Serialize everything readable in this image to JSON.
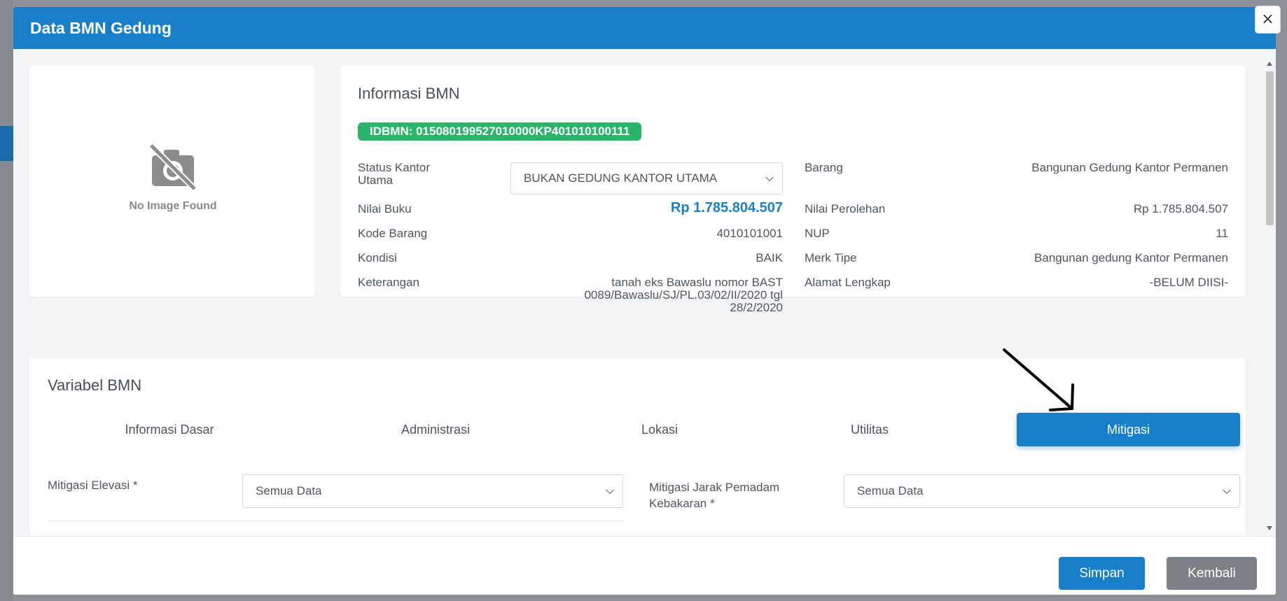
{
  "modal": {
    "title": "Data BMN Gedung",
    "close_label": "×"
  },
  "image_panel": {
    "placeholder_text": "No Image Found"
  },
  "info": {
    "title": "Informasi BMN",
    "idbmn": "IDBMN: 015080199527010000KP401010100111",
    "left": {
      "status_label": "Status Kantor Utama",
      "status_value": "BUKAN GEDUNG KANTOR UTAMA",
      "nilai_buku_label": "Nilai Buku",
      "nilai_buku_value": "Rp 1.785.804.507",
      "kode_barang_label": "Kode Barang",
      "kode_barang_value": "4010101001",
      "kondisi_label": "Kondisi",
      "kondisi_value": "BAIK",
      "keterangan_label": "Keterangan",
      "keterangan_value": "tanah eks Bawaslu nomor BAST 0089/Bawaslu/SJ/PL.03/02/II/2020 tgl 28/2/2020"
    },
    "right": {
      "barang_label": "Barang",
      "barang_value": "Bangunan Gedung Kantor Permanen",
      "nilai_perolehan_label": "Nilai Perolehan",
      "nilai_perolehan_value": "Rp 1.785.804.507",
      "nup_label": "NUP",
      "nup_value": "11",
      "merk_label": "Merk Tipe",
      "merk_value": "Bangunan gedung Kantor Permanen",
      "alamat_label": "Alamat Lengkap",
      "alamat_value": "-BELUM DIISI-"
    }
  },
  "variabel": {
    "title": "Variabel BMN",
    "tabs": [
      {
        "label": "Informasi Dasar"
      },
      {
        "label": "Administrasi"
      },
      {
        "label": "Lokasi"
      },
      {
        "label": "Utilitas"
      },
      {
        "label": "Mitigasi"
      }
    ],
    "active_tab": "Mitigasi",
    "fields": {
      "elevasi_label": "Mitigasi Elevasi *",
      "elevasi_value": "Semua Data",
      "jarak_label": "Mitigasi Jarak Pemadam Kebakaran *",
      "jarak_value": "Semua Data"
    }
  },
  "footer": {
    "save_label": "Simpan",
    "back_label": "Kembali"
  },
  "colors": {
    "header": "#1a7fc9",
    "badge": "#2bb56a",
    "back_button": "#7c8187"
  },
  "icons": {
    "image_placeholder": "no-image-icon",
    "close": "close-icon",
    "dropdown": "chevron-down-icon"
  }
}
